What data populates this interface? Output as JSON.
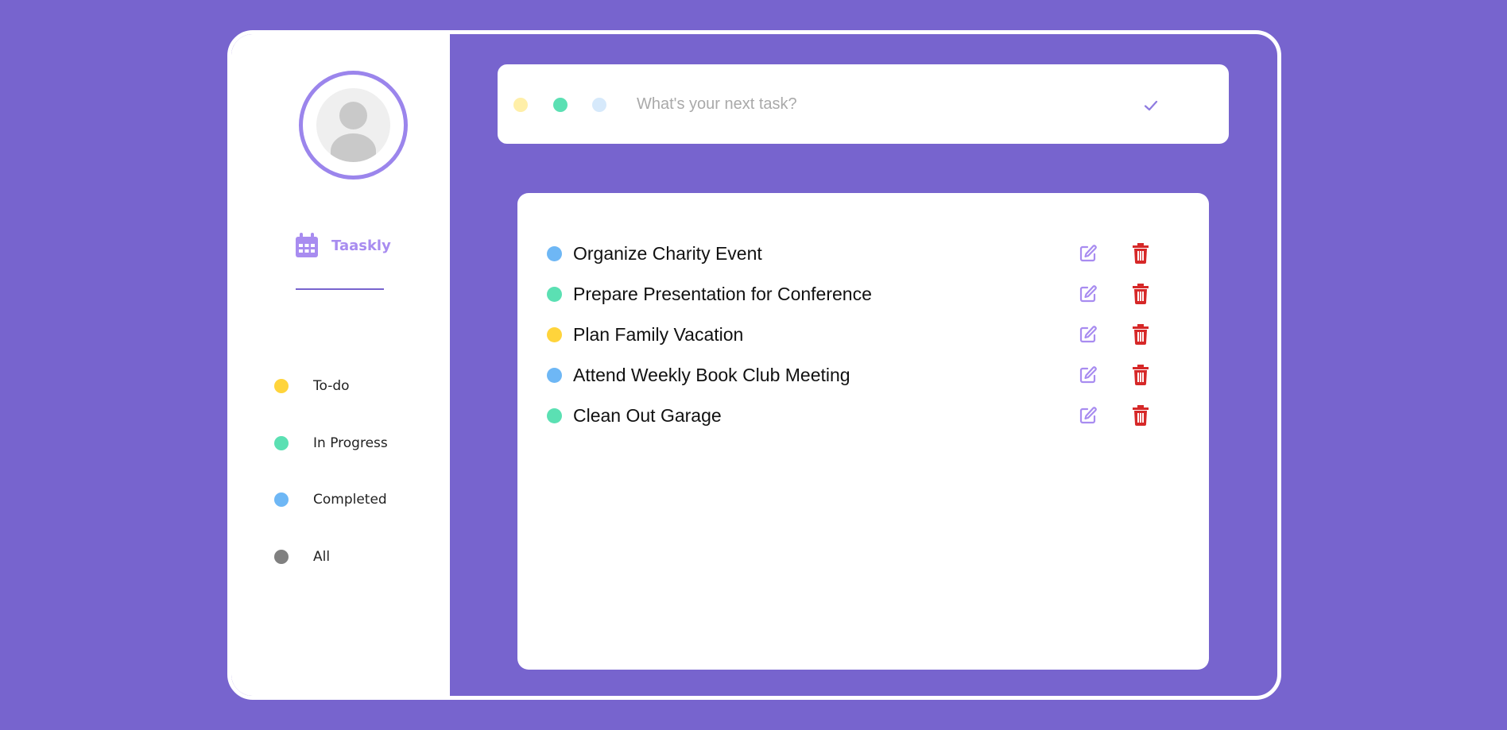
{
  "colors": {
    "background": "#7764CE",
    "accent": "#A88CF0",
    "todo": "#FFD43B",
    "in_progress": "#5BE0B3",
    "completed": "#6EB7F5",
    "all": "#808080",
    "delete": "#D62828"
  },
  "sidebar": {
    "brand": {
      "name": "Taaskly",
      "icon": "calendar-icon"
    },
    "avatar": {
      "icon": "user-avatar-icon"
    },
    "filters": [
      {
        "label": "To-do",
        "color": "#FFD43B"
      },
      {
        "label": "In Progress",
        "color": "#5BE0B3"
      },
      {
        "label": "Completed",
        "color": "#6EB7F5"
      },
      {
        "label": "All",
        "color": "#808080"
      }
    ]
  },
  "new_task": {
    "placeholder": "What's your next task?",
    "value": "",
    "status_options": [
      {
        "name": "todo",
        "color": "#FFEFA8"
      },
      {
        "name": "in-progress",
        "color": "#5BE0B3"
      },
      {
        "name": "completed",
        "color": "#D6E9FB"
      }
    ],
    "submit_icon": "check-icon"
  },
  "tasks": [
    {
      "title": "Organize Charity Event",
      "status_color": "#6EB7F5"
    },
    {
      "title": "Prepare Presentation for Conference",
      "status_color": "#5BE0B3"
    },
    {
      "title": "Plan Family Vacation",
      "status_color": "#FFD43B"
    },
    {
      "title": "Attend Weekly Book Club Meeting",
      "status_color": "#6EB7F5"
    },
    {
      "title": "Clean Out Garage",
      "status_color": "#5BE0B3"
    }
  ],
  "task_actions": {
    "edit_icon": "edit-icon",
    "delete_icon": "trash-icon"
  }
}
